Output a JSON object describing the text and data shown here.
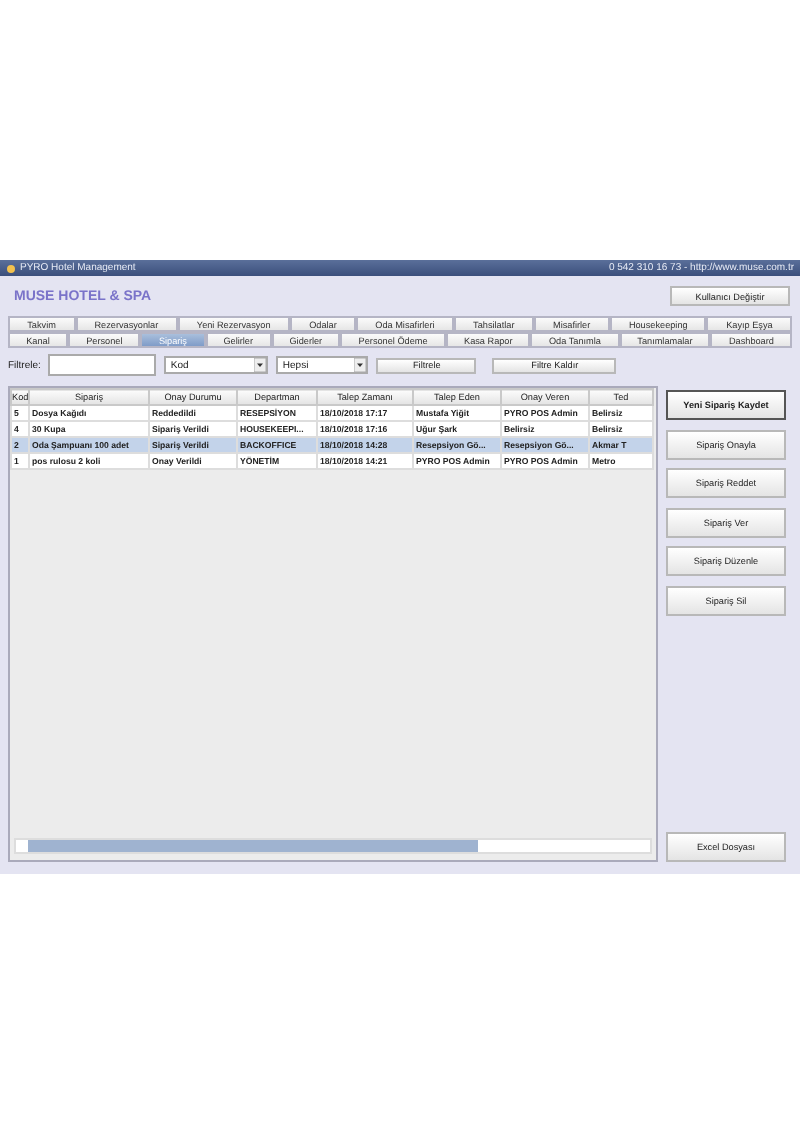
{
  "window": {
    "title": "PYRO Hotel Management",
    "contact": "0 542 310 16 73 - http://www.muse.com.tr"
  },
  "header": {
    "brand": "MUSE HOTEL & SPA",
    "user_button": "Kullanıcı Değiştir"
  },
  "tab_rows": [
    [
      {
        "label": "Takvim",
        "selected": false
      },
      {
        "label": "Rezervasyonlar",
        "selected": false
      },
      {
        "label": "Yeni Rezervasyon",
        "selected": false
      },
      {
        "label": "Odalar",
        "selected": false
      },
      {
        "label": "Oda Misafirleri",
        "selected": false
      },
      {
        "label": "Tahsilatlar",
        "selected": false
      },
      {
        "label": "Misafirler",
        "selected": false
      },
      {
        "label": "Housekeeping",
        "selected": false
      },
      {
        "label": "Kayıp Eşya",
        "selected": false
      }
    ],
    [
      {
        "label": "Kanal",
        "selected": false
      },
      {
        "label": "Personel",
        "selected": false
      },
      {
        "label": "Sipariş",
        "selected": true
      },
      {
        "label": "Gelirler",
        "selected": false
      },
      {
        "label": "Giderler",
        "selected": false
      },
      {
        "label": "Personel Ödeme",
        "selected": false
      },
      {
        "label": "Kasa Rapor",
        "selected": false
      },
      {
        "label": "Oda Tanımla",
        "selected": false
      },
      {
        "label": "Tanımlamalar",
        "selected": false
      },
      {
        "label": "Dashboard",
        "selected": false
      }
    ]
  ],
  "filter": {
    "label": "Filtrele:",
    "field_select": "Kod",
    "status_select": "Hepsi",
    "buttons": [
      "Filtrele",
      "Filtre Kaldır"
    ]
  },
  "table": {
    "columns": [
      "Kod",
      "Sipariş",
      "Onay Durumu",
      "Departman",
      "Talep Zamanı",
      "Talep Eden",
      "Onay Veren",
      "Ted"
    ],
    "rows": [
      {
        "cells": [
          "5",
          "Dosya Kağıdı",
          "Reddedildi",
          "RESEPSİYON",
          "18/10/2018 17:17",
          "Mustafa Yiğit",
          "PYRO POS Admin",
          "Belirsiz"
        ],
        "selected": false
      },
      {
        "cells": [
          "4",
          "30 Kupa",
          "Sipariş Verildi",
          "HOUSEKEEPI...",
          "18/10/2018 17:16",
          "Uğur Şark",
          "Belirsiz",
          "Belirsiz"
        ],
        "selected": false
      },
      {
        "cells": [
          "2",
          "Oda Şampuanı 100 adet",
          "Sipariş Verildi",
          "BACKOFFICE",
          "18/10/2018 14:28",
          "Resepsiyon Gö...",
          "Resepsiyon Gö...",
          "Akmar T"
        ],
        "selected": true
      },
      {
        "cells": [
          "1",
          "pos rulosu 2 koli",
          "Onay Verildi",
          "YÖNETİM",
          "18/10/2018 14:21",
          "PYRO POS Admin",
          "PYRO POS Admin",
          "Metro"
        ],
        "selected": false
      }
    ]
  },
  "actions": [
    {
      "label": "Yeni Sipariş Kaydet",
      "default": true
    },
    {
      "label": "Sipariş Onayla",
      "default": false
    },
    {
      "label": "Sipariş Reddet",
      "default": false
    },
    {
      "label": "Sipariş Ver",
      "default": false
    },
    {
      "label": "Sipariş Düzenle",
      "default": false
    },
    {
      "label": "Sipariş Sil",
      "default": false
    }
  ],
  "export_button": "Excel Dosyası"
}
